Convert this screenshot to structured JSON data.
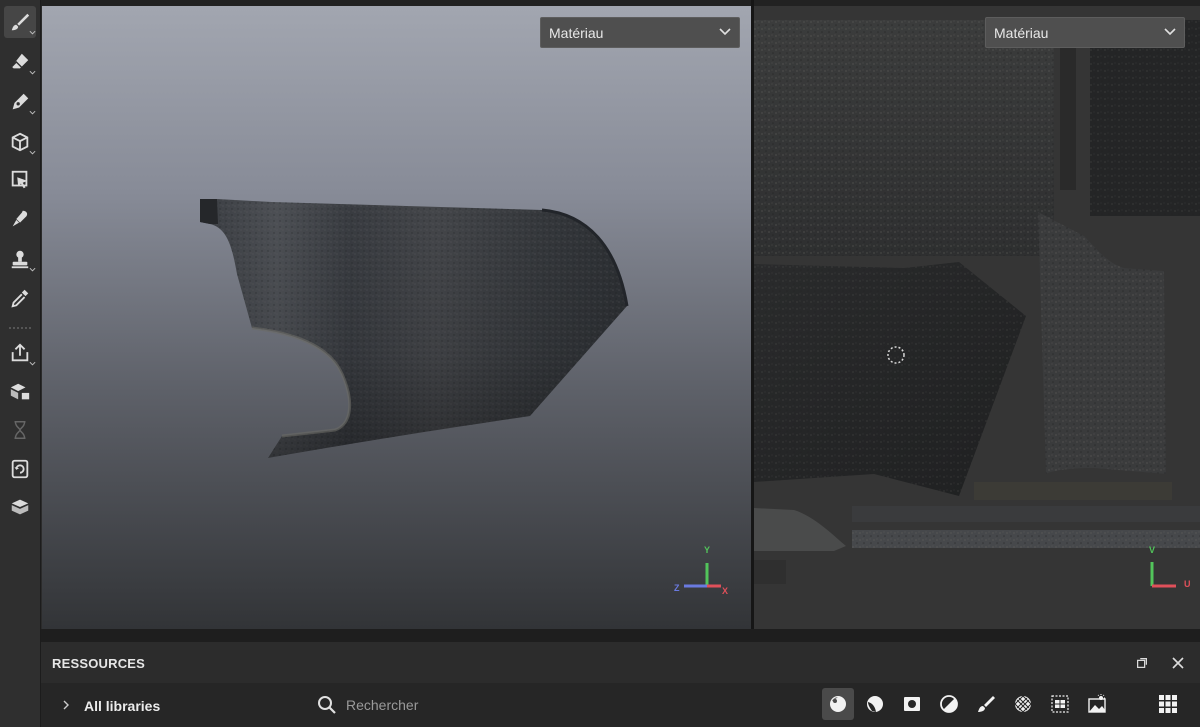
{
  "toolbar": {
    "tools": [
      {
        "name": "paint-brush-icon",
        "active": true
      },
      {
        "name": "eraser-icon"
      },
      {
        "name": "pen-icon"
      },
      {
        "name": "cube-projection-icon"
      },
      {
        "name": "polygon-fill-icon"
      },
      {
        "name": "smudge-icon"
      },
      {
        "name": "clone-stamp-icon"
      },
      {
        "name": "color-picker-icon"
      },
      {
        "name": "export-icon"
      },
      {
        "name": "bake-icon"
      },
      {
        "name": "hourglass-icon"
      },
      {
        "name": "refresh-icon"
      },
      {
        "name": "book-icon"
      }
    ]
  },
  "viewport3d": {
    "mode_selector": {
      "value": "Matériau"
    },
    "axis_gizmo": {
      "y": "Y",
      "z": "Z",
      "x": "X"
    },
    "colors": {
      "y_axis": "#52c45b",
      "x_axis": "#e0505a",
      "z_axis": "#6a7ae0"
    }
  },
  "viewport2d": {
    "mode_selector": {
      "value": "Matériau"
    },
    "axis_gizmo": {
      "v": "V",
      "u": "U"
    }
  },
  "resources": {
    "title": "RESSOURCES",
    "library": "All libraries",
    "search": {
      "placeholder": "Rechercher",
      "value": ""
    },
    "filters": [
      {
        "name": "material-filter-icon",
        "active": true
      },
      {
        "name": "smart-material-filter-icon"
      },
      {
        "name": "mask-filter-icon"
      },
      {
        "name": "generator-filter-icon"
      },
      {
        "name": "brush-filter-icon"
      },
      {
        "name": "texture-filter-icon"
      },
      {
        "name": "alpha-filter-icon"
      },
      {
        "name": "environment-filter-icon"
      }
    ]
  }
}
